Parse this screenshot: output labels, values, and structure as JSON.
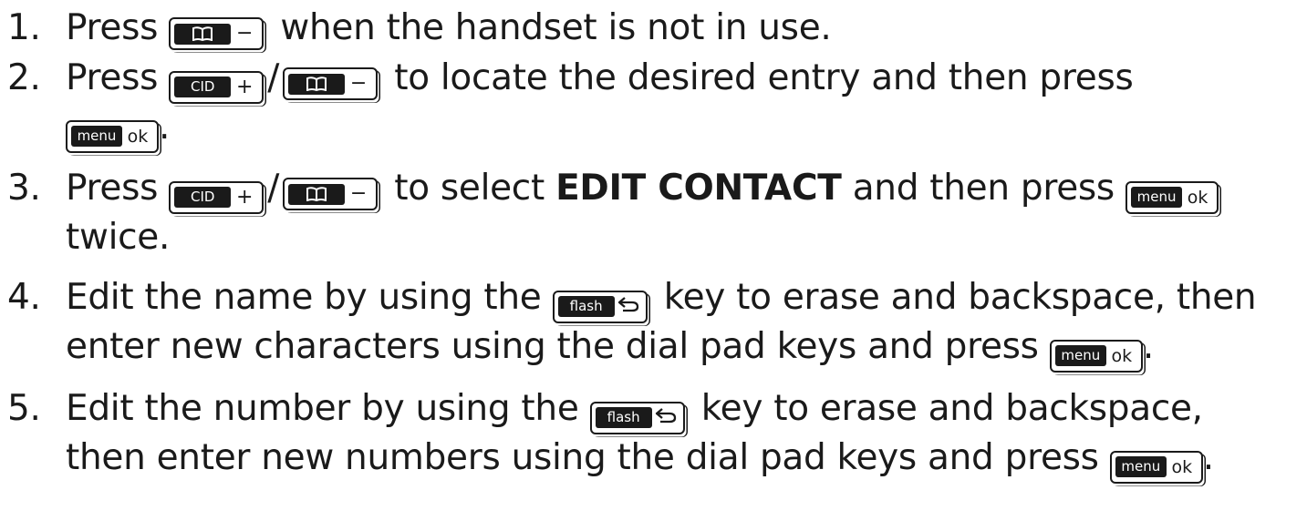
{
  "steps": [
    {
      "num": "1.",
      "a": "Press",
      "b": "when the handset is not in use."
    },
    {
      "num": "2.",
      "a": "Press",
      "slash": "/",
      "b": "to locate the desired entry and then press",
      "c": "."
    },
    {
      "num": "3.",
      "a": "Press",
      "slash": "/",
      "b": "to select",
      "bold": "EDIT CONTACT",
      "c": "and then press",
      "d": "twice."
    },
    {
      "num": "4.",
      "a": "Edit the name by using the",
      "b": "key to erase and backspace, then",
      "c": "enter new characters using the dial pad keys and press",
      "d": "."
    },
    {
      "num": "5.",
      "a": "Edit the number by using the",
      "b": "key to erase and backspace,",
      "c": "then enter new numbers using the dial pad keys and press",
      "d": "."
    }
  ],
  "keys": {
    "cid": {
      "label": "CID",
      "symbol": "+"
    },
    "book": {
      "icon": "phonebook-icon",
      "symbol": "−"
    },
    "menu": {
      "label": "menu",
      "symbol": "ok"
    },
    "flash": {
      "label": "flash",
      "icon": "back-arrow-icon"
    }
  },
  "colors": {
    "text": "#1a1a1a",
    "key_plate": "#1a1a1a",
    "background": "#ffffff"
  }
}
